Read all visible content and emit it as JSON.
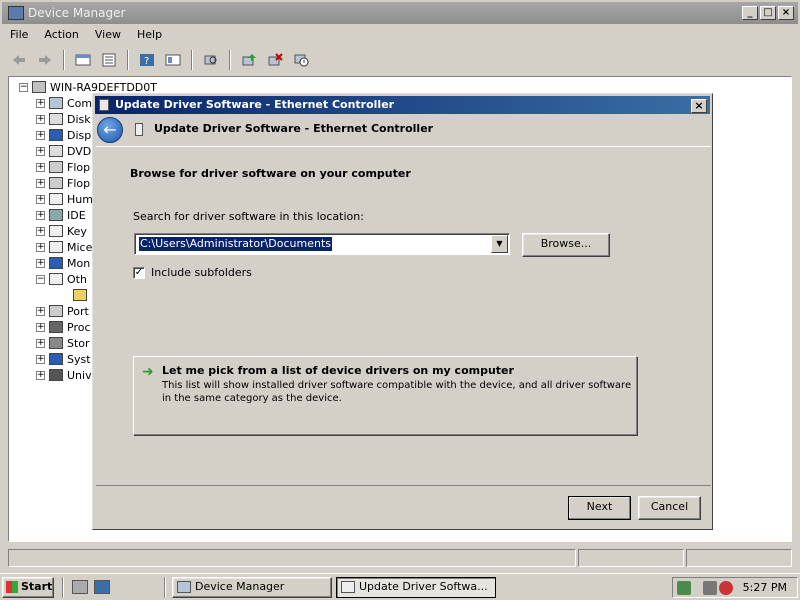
{
  "device_manager": {
    "title": "Device Manager",
    "menu": [
      "File",
      "Action",
      "View",
      "Help"
    ],
    "toolbar_icons": [
      "back-icon",
      "forward-icon",
      "up-icon",
      "properties-icon",
      "help-icon",
      "view-icon",
      "scan-hardware-icon",
      "update-driver-icon",
      "uninstall-icon",
      "disable-icon"
    ],
    "tree": {
      "root": "WIN-RA9DEFTDD0T",
      "items": [
        "Com",
        "Disk",
        "Disp",
        "DVD",
        "Flop",
        "Flop",
        "Hum",
        "IDE",
        "Key",
        "Mice",
        "Mon",
        "Oth",
        "",
        "Port",
        "Proc",
        "Stor",
        "Syst",
        "Univ"
      ]
    }
  },
  "dialog": {
    "window_title": "Update Driver Software - Ethernet Controller",
    "wizard_title": "Update Driver Software - Ethernet Controller",
    "heading": "Browse for driver software on your computer",
    "search_label": "Search for driver software in this location:",
    "path_value": "C:\\Users\\Administrator\\Documents",
    "browse_label": "Browse...",
    "include_subfolders_label": "Include subfolders",
    "include_subfolders_checked": true,
    "pick_title": "Let me pick from a list of device drivers on my computer",
    "pick_description": "This list will show installed driver software compatible with the device, and all driver software in the same category as the device.",
    "next_label": "Next",
    "cancel_label": "Cancel"
  },
  "taskbar": {
    "start_label": "Start",
    "tasks": [
      {
        "label": "Device Manager",
        "active": false
      },
      {
        "label": "Update Driver Softwa...",
        "active": true
      }
    ],
    "clock": "5:27 PM"
  },
  "colors": {
    "title_active": "#0a246a",
    "title_inactive": "#8e8e8e",
    "selection": "#0a246a",
    "face": "#d4d0c8"
  }
}
